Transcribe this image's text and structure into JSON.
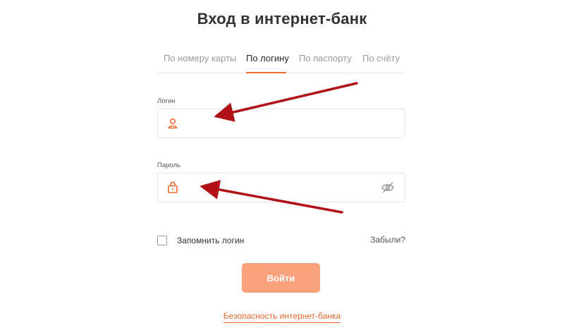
{
  "page": {
    "title": "Вход в интернет-банк"
  },
  "tabs": [
    {
      "label": "По номеру карты",
      "active": false
    },
    {
      "label": "По логину",
      "active": true
    },
    {
      "label": "По паспорту",
      "active": false
    },
    {
      "label": "По счёту",
      "active": false
    }
  ],
  "login_field": {
    "label": "Логин",
    "value": "",
    "icon": "user-icon"
  },
  "password_field": {
    "label": "Пароль",
    "value": "",
    "icon": "lock-icon",
    "toggle_icon": "eye-off-icon"
  },
  "remember": {
    "label": "Запомнить логин",
    "checked": false
  },
  "forgot_label": "Забыли?",
  "submit_label": "Войти",
  "security_link": "Безопасность интернет-банка",
  "colors": {
    "accent": "#f26a2e",
    "button": "#f8a37c",
    "arrow": "#b01218",
    "link": "#e8672b"
  }
}
